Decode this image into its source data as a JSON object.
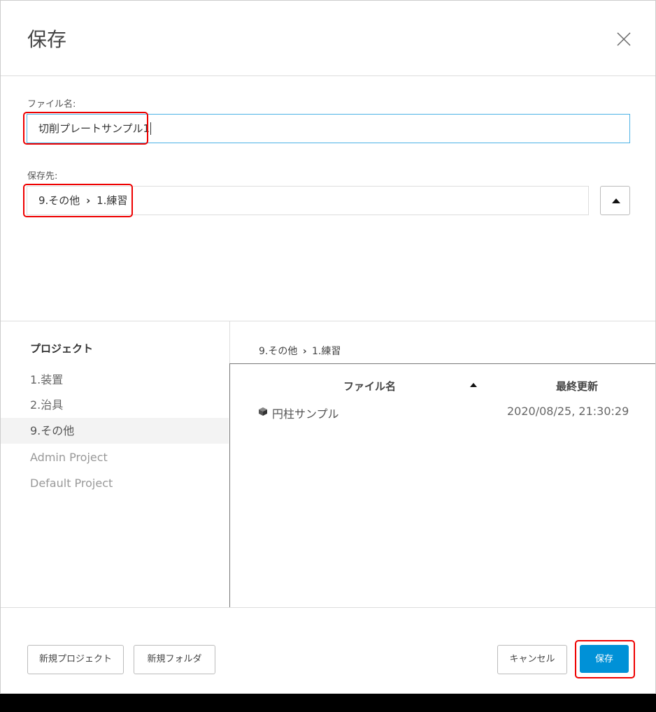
{
  "dialog": {
    "title": "保存",
    "close_icon": "close-icon"
  },
  "filename": {
    "label": "ファイル名:",
    "value": "切削プレートサンプル1"
  },
  "destination": {
    "label": "保存先:",
    "folder": "9.その他",
    "separator": "›",
    "subfolder": "1.練習",
    "expand_icon": "triangle-up-icon"
  },
  "sidebar": {
    "title": "プロジェクト",
    "items": [
      {
        "label": "1.装置"
      },
      {
        "label": "2.治具"
      },
      {
        "label": "9.その他"
      },
      {
        "label": "Admin Project"
      },
      {
        "label": "Default Project"
      }
    ],
    "selected_index": 2
  },
  "browser": {
    "breadcrumb_folder": "9.その他",
    "breadcrumb_separator": "›",
    "breadcrumb_subfolder": "1.練習",
    "columns": {
      "name": "ファイル名",
      "modified": "最終更新",
      "sort_icon": "sort-ascending-icon"
    },
    "files": [
      {
        "icon": "cube-icon",
        "name": "円柱サンプル",
        "modified": "2020/08/25, 21:30:29"
      }
    ]
  },
  "footer": {
    "new_project": "新規プロジェクト",
    "new_folder": "新規フォルダ",
    "cancel": "キャンセル",
    "save": "保存"
  },
  "colors": {
    "accent": "#0091d7",
    "input_focus": "#4db3e6",
    "highlight_box": "#e00000"
  }
}
